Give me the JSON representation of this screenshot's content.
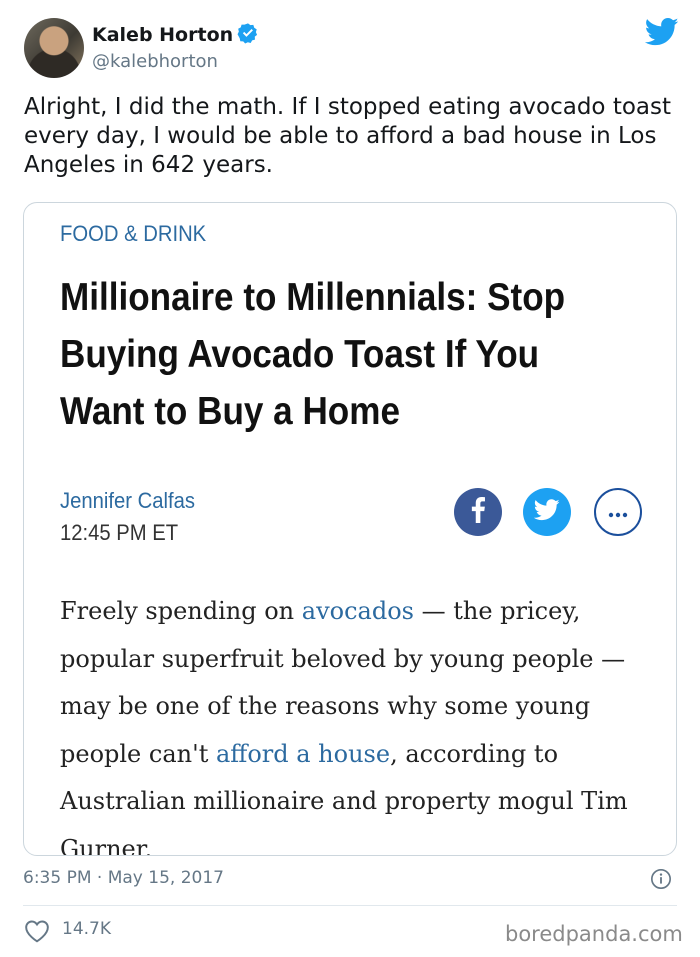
{
  "author": {
    "name": "Kaleb Horton",
    "handle": "@kalebhorton",
    "verified": true
  },
  "tweet": {
    "text": "Alright, I did the math. If I stopped eating avocado toast every day, I would be able to afford a bad house in Los Angeles in 642 years.",
    "date": "6:35 PM · May 15, 2017",
    "likes": "14.7K"
  },
  "article": {
    "category": "FOOD & DRINK",
    "headline_lines": [
      "Millionaire to Millennials: Stop",
      "Buying Avocado Toast If You",
      "Want to Buy a Home"
    ],
    "author": "Jennifer Calfas",
    "time": "12:45 PM ET",
    "body": {
      "p1": "Freely spending on ",
      "link1": "avocados",
      "p2": " — the pricey, popular superfruit beloved by young people — may be one of the reasons why some young people can't ",
      "link2": "afford a house",
      "p3": ", according to Australian millionaire and property mogul Tim Gurner."
    }
  },
  "icons": {
    "twitter": "twitter-bird-icon",
    "verified": "verified-badge-icon",
    "facebook": "facebook-icon",
    "share_twitter": "twitter-icon",
    "more": "more-dots-icon",
    "info": "info-icon",
    "like": "heart-icon"
  },
  "colors": {
    "twitter_blue": "#1da1f2",
    "link_blue": "#2c6aa0",
    "facebook_blue": "#3b5998",
    "muted": "#657786"
  },
  "watermark": "boredpanda.com"
}
